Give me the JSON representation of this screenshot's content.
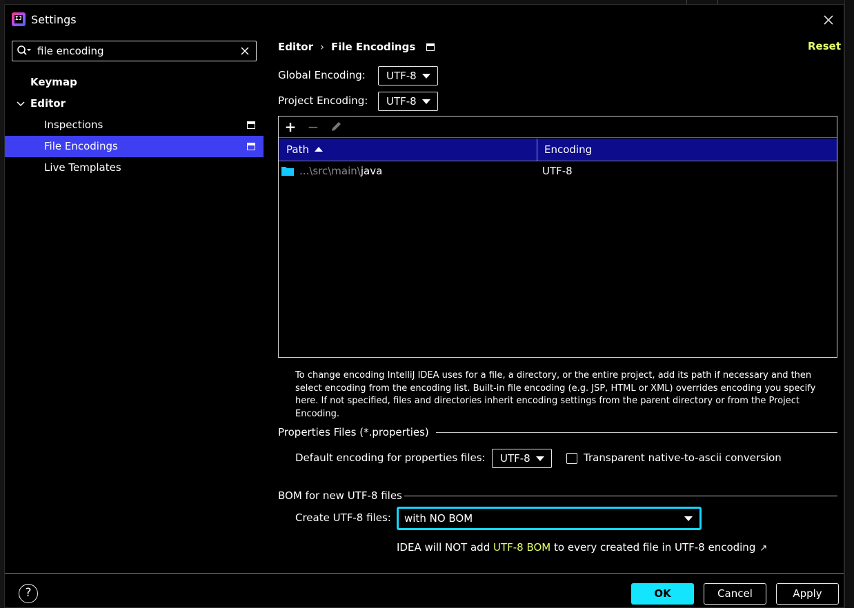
{
  "window": {
    "title": "Settings"
  },
  "search": {
    "value": "file encoding"
  },
  "sidebar": {
    "items": [
      {
        "label": "Keymap"
      },
      {
        "label": "Editor"
      },
      {
        "label": "Inspections"
      },
      {
        "label": "File Encodings"
      },
      {
        "label": "Live Templates"
      }
    ]
  },
  "breadcrumb": {
    "parent": "Editor",
    "separator": "›",
    "current": "File Encodings"
  },
  "reset_label": "Reset",
  "global_encoding": {
    "label": "Global Encoding:",
    "value": "UTF-8"
  },
  "project_encoding": {
    "label": "Project Encoding:",
    "value": "UTF-8"
  },
  "table": {
    "columns": [
      "Path",
      "Encoding"
    ],
    "rows": [
      {
        "path_prefix": "...\\src\\main\\",
        "path_name": "java",
        "encoding": "UTF-8"
      }
    ]
  },
  "help_text": "To change encoding IntelliJ IDEA uses for a file, a directory, or the entire project, add its path if necessary and then select encoding from the encoding list. Built-in file encoding (e.g. JSP, HTML or XML) overrides encoding you specify here. If not specified, files and directories inherit encoding settings from the parent directory or from the Project Encoding.",
  "properties_section": {
    "title": "Properties Files (*.properties)",
    "default_label": "Default encoding for properties files:",
    "default_value": "UTF-8",
    "transparent_label": "Transparent native-to-ascii conversion",
    "transparent_checked": false
  },
  "bom_section": {
    "title": "BOM for new UTF-8 files",
    "create_label": "Create UTF-8 files:",
    "create_value": "with NO BOM",
    "note_prefix": "IDEA will NOT add ",
    "note_link": "UTF-8 BOM",
    "note_suffix": " to every created file in UTF-8 encoding",
    "note_arrow": "↗"
  },
  "footer": {
    "help": "?",
    "ok": "OK",
    "cancel": "Cancel",
    "apply": "Apply"
  },
  "colors": {
    "selection": "#3d3ff0",
    "table_header": "#0c0c8c",
    "accent_cyan": "#13e5ff",
    "link_yellow": "#e7ff6b"
  }
}
